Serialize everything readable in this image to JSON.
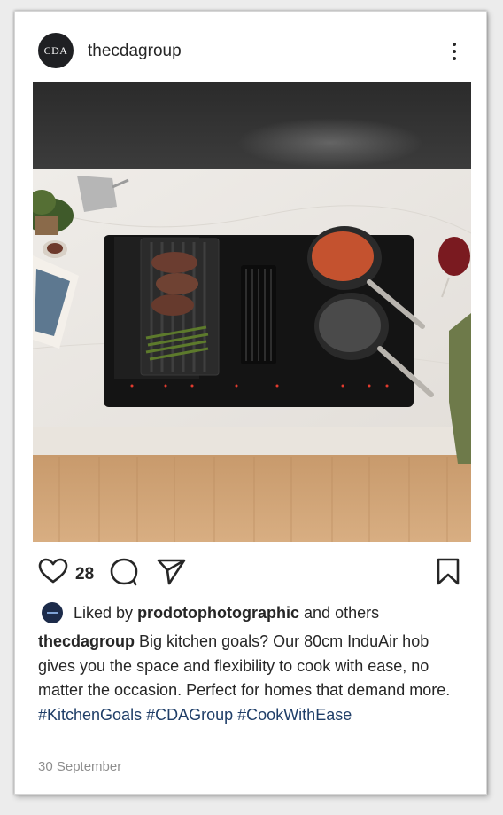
{
  "post": {
    "avatar_text": "CDA",
    "username": "thecdagroup",
    "like_count": "28",
    "liked_by_prefix": "Liked by",
    "liked_by_user": "prodotophotographic",
    "liked_by_suffix": "and others",
    "caption_user": "thecdagroup",
    "caption_text": "Big kitchen goals? Our 80cm InduAir hob gives you the space and flexibility to cook with ease, no matter the occasion. Perfect for homes that demand more.",
    "hashtags": [
      "#KitchenGoals",
      "#CDAGroup",
      "#CookWithEase"
    ],
    "date": "30 September"
  },
  "icons": {
    "more": "more-vertical-icon",
    "like": "heart-icon",
    "comment": "comment-icon",
    "share": "send-icon",
    "save": "bookmark-icon"
  },
  "colors": {
    "hashtag": "#1f3e68",
    "text": "#262626",
    "muted": "#8e8e8e"
  }
}
